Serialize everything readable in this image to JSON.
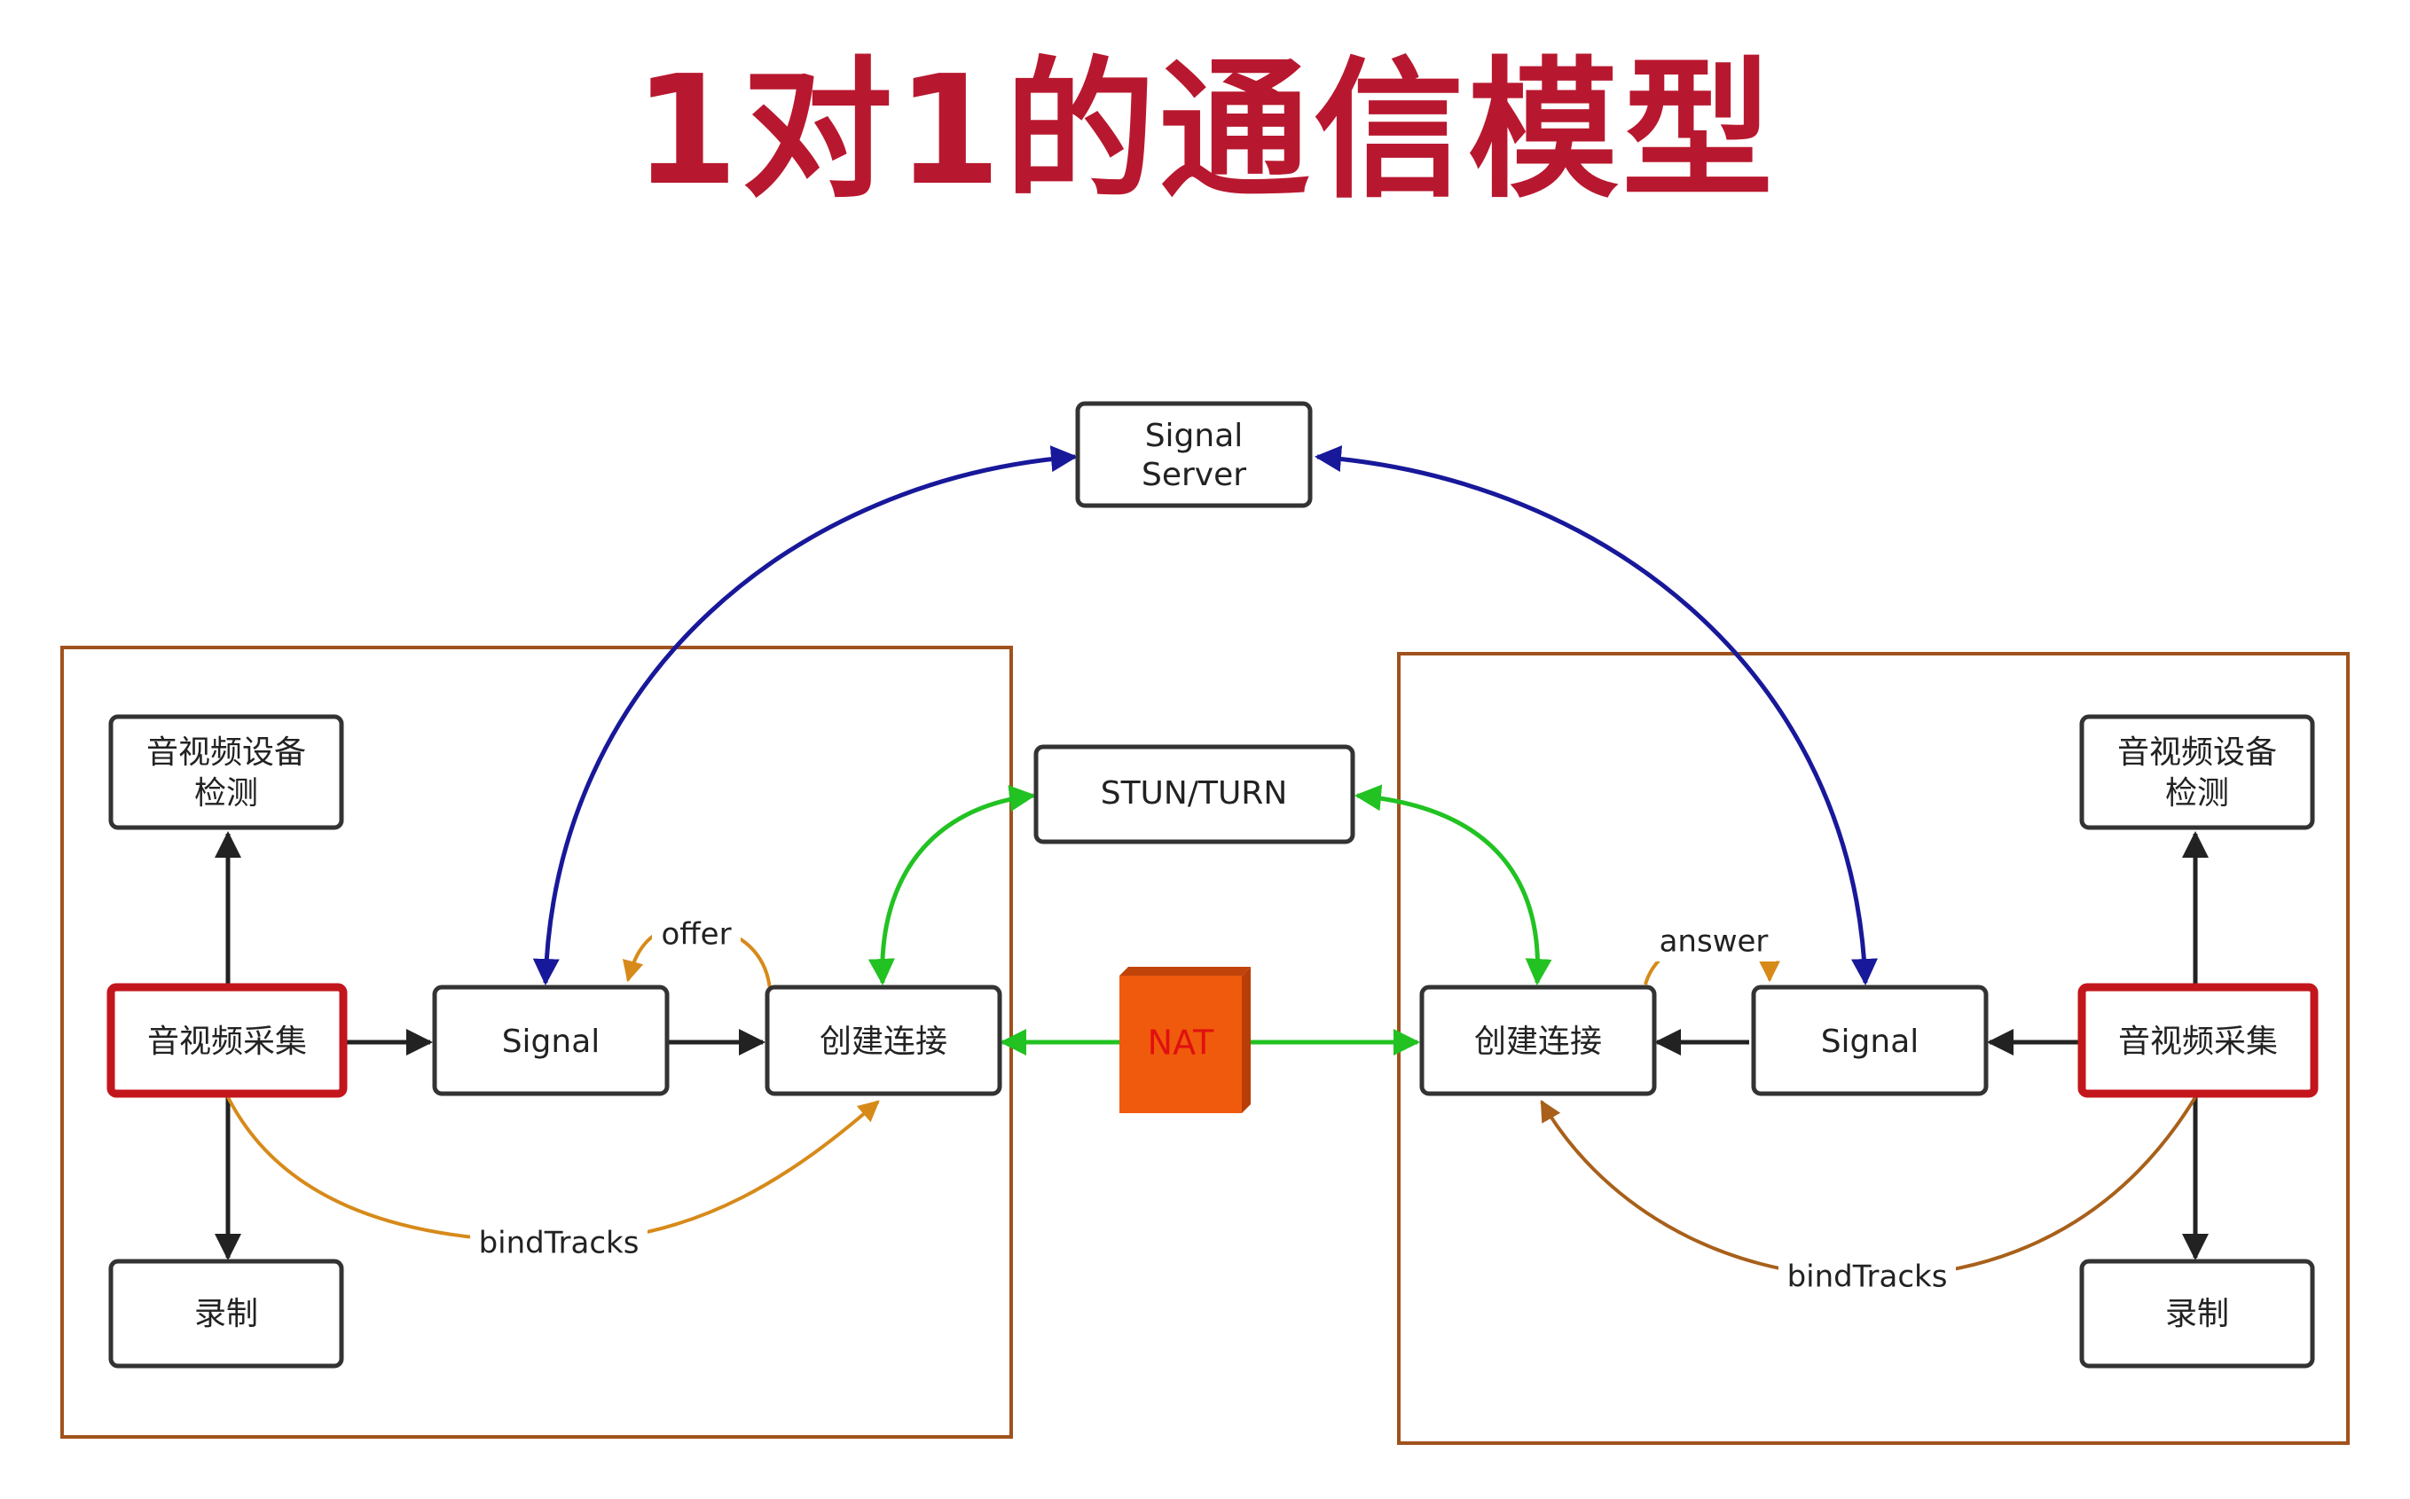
{
  "title": "1对1的通信模型",
  "nodes": {
    "signal_server": [
      "Signal",
      "Server"
    ],
    "stun_turn": "STUN/TURN",
    "nat": "NAT",
    "left": {
      "device_check": [
        "音视频设备",
        "检测"
      ],
      "capture": "音视频采集",
      "record": "录制",
      "signal": "Signal",
      "connect": "创建连接"
    },
    "right": {
      "device_check": [
        "音视频设备",
        "检测"
      ],
      "capture": "音视频采集",
      "record": "录制",
      "signal": "Signal",
      "connect": "创建连接"
    }
  },
  "edge_labels": {
    "offer": "offer",
    "answer": "answer",
    "left_bind": "bindTracks",
    "right_bind": "bindTracks"
  },
  "colors": {
    "title": "#b8182f",
    "signaling": "#18189a",
    "ice": "#22c222",
    "flow": "#222222",
    "bind_left": "#d78a1a",
    "bind_right": "#a8601a",
    "capture_border": "#c3161c",
    "nat_fill": "#f05a0c",
    "frame": "#a0521c"
  }
}
